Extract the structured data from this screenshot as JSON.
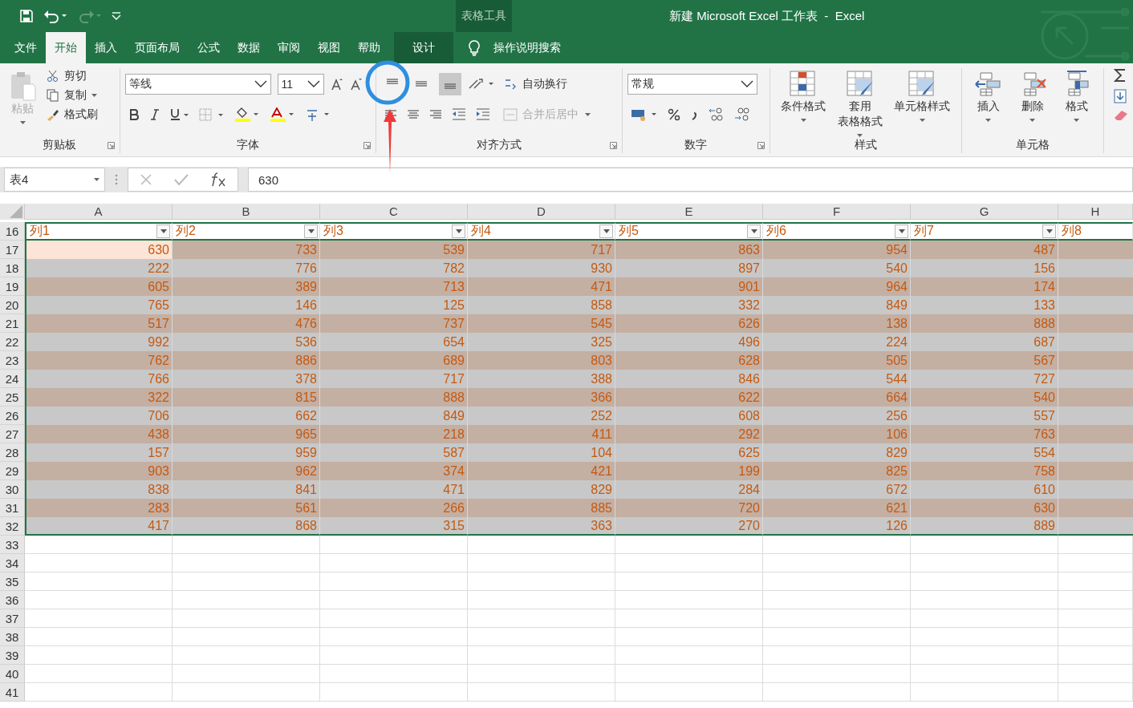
{
  "title_bar": {
    "context_group": "表格工具",
    "title": "新建 Microsoft Excel 工作表  -  Excel"
  },
  "ribbon_tabs": [
    {
      "label": "文件",
      "selected": false,
      "kind": "normal"
    },
    {
      "label": "开始",
      "selected": true,
      "kind": "normal"
    },
    {
      "label": "插入",
      "selected": false,
      "kind": "normal"
    },
    {
      "label": "页面布局",
      "selected": false,
      "kind": "normal"
    },
    {
      "label": "公式",
      "selected": false,
      "kind": "normal"
    },
    {
      "label": "数据",
      "selected": false,
      "kind": "normal"
    },
    {
      "label": "审阅",
      "selected": false,
      "kind": "normal"
    },
    {
      "label": "视图",
      "selected": false,
      "kind": "normal"
    },
    {
      "label": "帮助",
      "selected": false,
      "kind": "normal"
    },
    {
      "label": "设计",
      "selected": false,
      "kind": "contextual"
    }
  ],
  "tell_me": {
    "placeholder": "操作说明搜索"
  },
  "clipboard": {
    "label": "剪贴板",
    "paste": {
      "label": "粘贴",
      "disabled": true
    },
    "cut": "剪切",
    "copy": "复制",
    "format_painter": "格式刷"
  },
  "font": {
    "label": "字体",
    "font_name": "等线",
    "font_size": "11"
  },
  "alignment": {
    "label": "对齐方式",
    "vertical_buttons": [
      {
        "selected": false
      },
      {
        "selected": false
      },
      {
        "selected": true
      }
    ],
    "wrap_text": "自动换行",
    "merge": {
      "label": "合并后居中",
      "disabled": true
    }
  },
  "number": {
    "label": "数字",
    "format": "常规"
  },
  "styles": {
    "label": "样式",
    "buttons": [
      {
        "lines": [
          "条件格式"
        ]
      },
      {
        "lines": [
          "套用",
          "表格格式"
        ]
      },
      {
        "lines": [
          "单元格样式"
        ]
      }
    ]
  },
  "cells": {
    "label": "单元格",
    "buttons": [
      "插入",
      "删除",
      "格式"
    ]
  },
  "formula_bar": {
    "name_box": "表4",
    "formula": "630"
  },
  "sheet": {
    "columns": [
      "A",
      "B",
      "C",
      "D",
      "E",
      "F",
      "G",
      "H"
    ],
    "header_row": {
      "number": "16",
      "headers": [
        "列1",
        "列2",
        "列3",
        "列4",
        "列5",
        "列6",
        "列7",
        "列8"
      ]
    },
    "rows": [
      {
        "number": "17",
        "cells": [
          {
            "value": "630",
            "selected": true
          },
          {
            "value": "733",
            "selected": false
          },
          {
            "value": "539",
            "selected": false
          },
          {
            "value": "717",
            "selected": false
          },
          {
            "value": "863",
            "selected": false
          },
          {
            "value": "954",
            "selected": false
          },
          {
            "value": "487",
            "selected": false
          }
        ]
      },
      {
        "number": "18",
        "cells": [
          {
            "value": "222",
            "selected": false
          },
          {
            "value": "776",
            "selected": false
          },
          {
            "value": "782",
            "selected": false
          },
          {
            "value": "930",
            "selected": false
          },
          {
            "value": "897",
            "selected": false
          },
          {
            "value": "540",
            "selected": false
          },
          {
            "value": "156",
            "selected": false
          }
        ]
      },
      {
        "number": "19",
        "cells": [
          {
            "value": "605",
            "selected": false
          },
          {
            "value": "389",
            "selected": false
          },
          {
            "value": "713",
            "selected": false
          },
          {
            "value": "471",
            "selected": false
          },
          {
            "value": "901",
            "selected": false
          },
          {
            "value": "964",
            "selected": false
          },
          {
            "value": "174",
            "selected": false
          }
        ]
      },
      {
        "number": "20",
        "cells": [
          {
            "value": "765",
            "selected": false
          },
          {
            "value": "146",
            "selected": false
          },
          {
            "value": "125",
            "selected": false
          },
          {
            "value": "858",
            "selected": false
          },
          {
            "value": "332",
            "selected": false
          },
          {
            "value": "849",
            "selected": false
          },
          {
            "value": "133",
            "selected": false
          }
        ]
      },
      {
        "number": "21",
        "cells": [
          {
            "value": "517",
            "selected": false
          },
          {
            "value": "476",
            "selected": false
          },
          {
            "value": "737",
            "selected": false
          },
          {
            "value": "545",
            "selected": false
          },
          {
            "value": "626",
            "selected": false
          },
          {
            "value": "138",
            "selected": false
          },
          {
            "value": "888",
            "selected": false
          }
        ]
      },
      {
        "number": "22",
        "cells": [
          {
            "value": "992",
            "selected": false
          },
          {
            "value": "536",
            "selected": false
          },
          {
            "value": "654",
            "selected": false
          },
          {
            "value": "325",
            "selected": false
          },
          {
            "value": "496",
            "selected": false
          },
          {
            "value": "224",
            "selected": false
          },
          {
            "value": "687",
            "selected": false
          }
        ]
      },
      {
        "number": "23",
        "cells": [
          {
            "value": "762",
            "selected": false
          },
          {
            "value": "886",
            "selected": false
          },
          {
            "value": "689",
            "selected": false
          },
          {
            "value": "803",
            "selected": false
          },
          {
            "value": "628",
            "selected": false
          },
          {
            "value": "505",
            "selected": false
          },
          {
            "value": "567",
            "selected": false
          }
        ]
      },
      {
        "number": "24",
        "cells": [
          {
            "value": "766",
            "selected": false
          },
          {
            "value": "378",
            "selected": false
          },
          {
            "value": "717",
            "selected": false
          },
          {
            "value": "388",
            "selected": false
          },
          {
            "value": "846",
            "selected": false
          },
          {
            "value": "544",
            "selected": false
          },
          {
            "value": "727",
            "selected": false
          }
        ]
      },
      {
        "number": "25",
        "cells": [
          {
            "value": "322",
            "selected": false
          },
          {
            "value": "815",
            "selected": false
          },
          {
            "value": "888",
            "selected": false
          },
          {
            "value": "366",
            "selected": false
          },
          {
            "value": "622",
            "selected": false
          },
          {
            "value": "664",
            "selected": false
          },
          {
            "value": "540",
            "selected": false
          }
        ]
      },
      {
        "number": "26",
        "cells": [
          {
            "value": "706",
            "selected": false
          },
          {
            "value": "662",
            "selected": false
          },
          {
            "value": "849",
            "selected": false
          },
          {
            "value": "252",
            "selected": false
          },
          {
            "value": "608",
            "selected": false
          },
          {
            "value": "256",
            "selected": false
          },
          {
            "value": "557",
            "selected": false
          }
        ]
      },
      {
        "number": "27",
        "cells": [
          {
            "value": "438",
            "selected": false
          },
          {
            "value": "965",
            "selected": false
          },
          {
            "value": "218",
            "selected": false
          },
          {
            "value": "411",
            "selected": false
          },
          {
            "value": "292",
            "selected": false
          },
          {
            "value": "106",
            "selected": false
          },
          {
            "value": "763",
            "selected": false
          }
        ]
      },
      {
        "number": "28",
        "cells": [
          {
            "value": "157",
            "selected": false
          },
          {
            "value": "959",
            "selected": false
          },
          {
            "value": "587",
            "selected": false
          },
          {
            "value": "104",
            "selected": false
          },
          {
            "value": "625",
            "selected": false
          },
          {
            "value": "829",
            "selected": false
          },
          {
            "value": "554",
            "selected": false
          }
        ]
      },
      {
        "number": "29",
        "cells": [
          {
            "value": "903",
            "selected": false
          },
          {
            "value": "962",
            "selected": false
          },
          {
            "value": "374",
            "selected": false
          },
          {
            "value": "421",
            "selected": false
          },
          {
            "value": "199",
            "selected": false
          },
          {
            "value": "825",
            "selected": false
          },
          {
            "value": "758",
            "selected": false
          }
        ]
      },
      {
        "number": "30",
        "cells": [
          {
            "value": "838",
            "selected": false
          },
          {
            "value": "841",
            "selected": false
          },
          {
            "value": "471",
            "selected": false
          },
          {
            "value": "829",
            "selected": false
          },
          {
            "value": "284",
            "selected": false
          },
          {
            "value": "672",
            "selected": false
          },
          {
            "value": "610",
            "selected": false
          }
        ]
      },
      {
        "number": "31",
        "cells": [
          {
            "value": "283",
            "selected": false
          },
          {
            "value": "561",
            "selected": false
          },
          {
            "value": "266",
            "selected": false
          },
          {
            "value": "885",
            "selected": false
          },
          {
            "value": "720",
            "selected": false
          },
          {
            "value": "621",
            "selected": false
          },
          {
            "value": "630",
            "selected": false
          }
        ]
      },
      {
        "number": "32",
        "cells": [
          {
            "value": "417",
            "selected": false
          },
          {
            "value": "868",
            "selected": false
          },
          {
            "value": "315",
            "selected": false
          },
          {
            "value": "363",
            "selected": false
          },
          {
            "value": "270",
            "selected": false
          },
          {
            "value": "126",
            "selected": false
          },
          {
            "value": "889",
            "selected": false
          }
        ]
      }
    ],
    "empty_rows": [
      "33",
      "34",
      "35",
      "36",
      "37",
      "38",
      "39",
      "40",
      "41"
    ]
  },
  "annotations": [
    {
      "kind": "circle",
      "color": "#2e8fe0"
    },
    {
      "kind": "arrow",
      "color": "#f03a3a"
    }
  ]
}
